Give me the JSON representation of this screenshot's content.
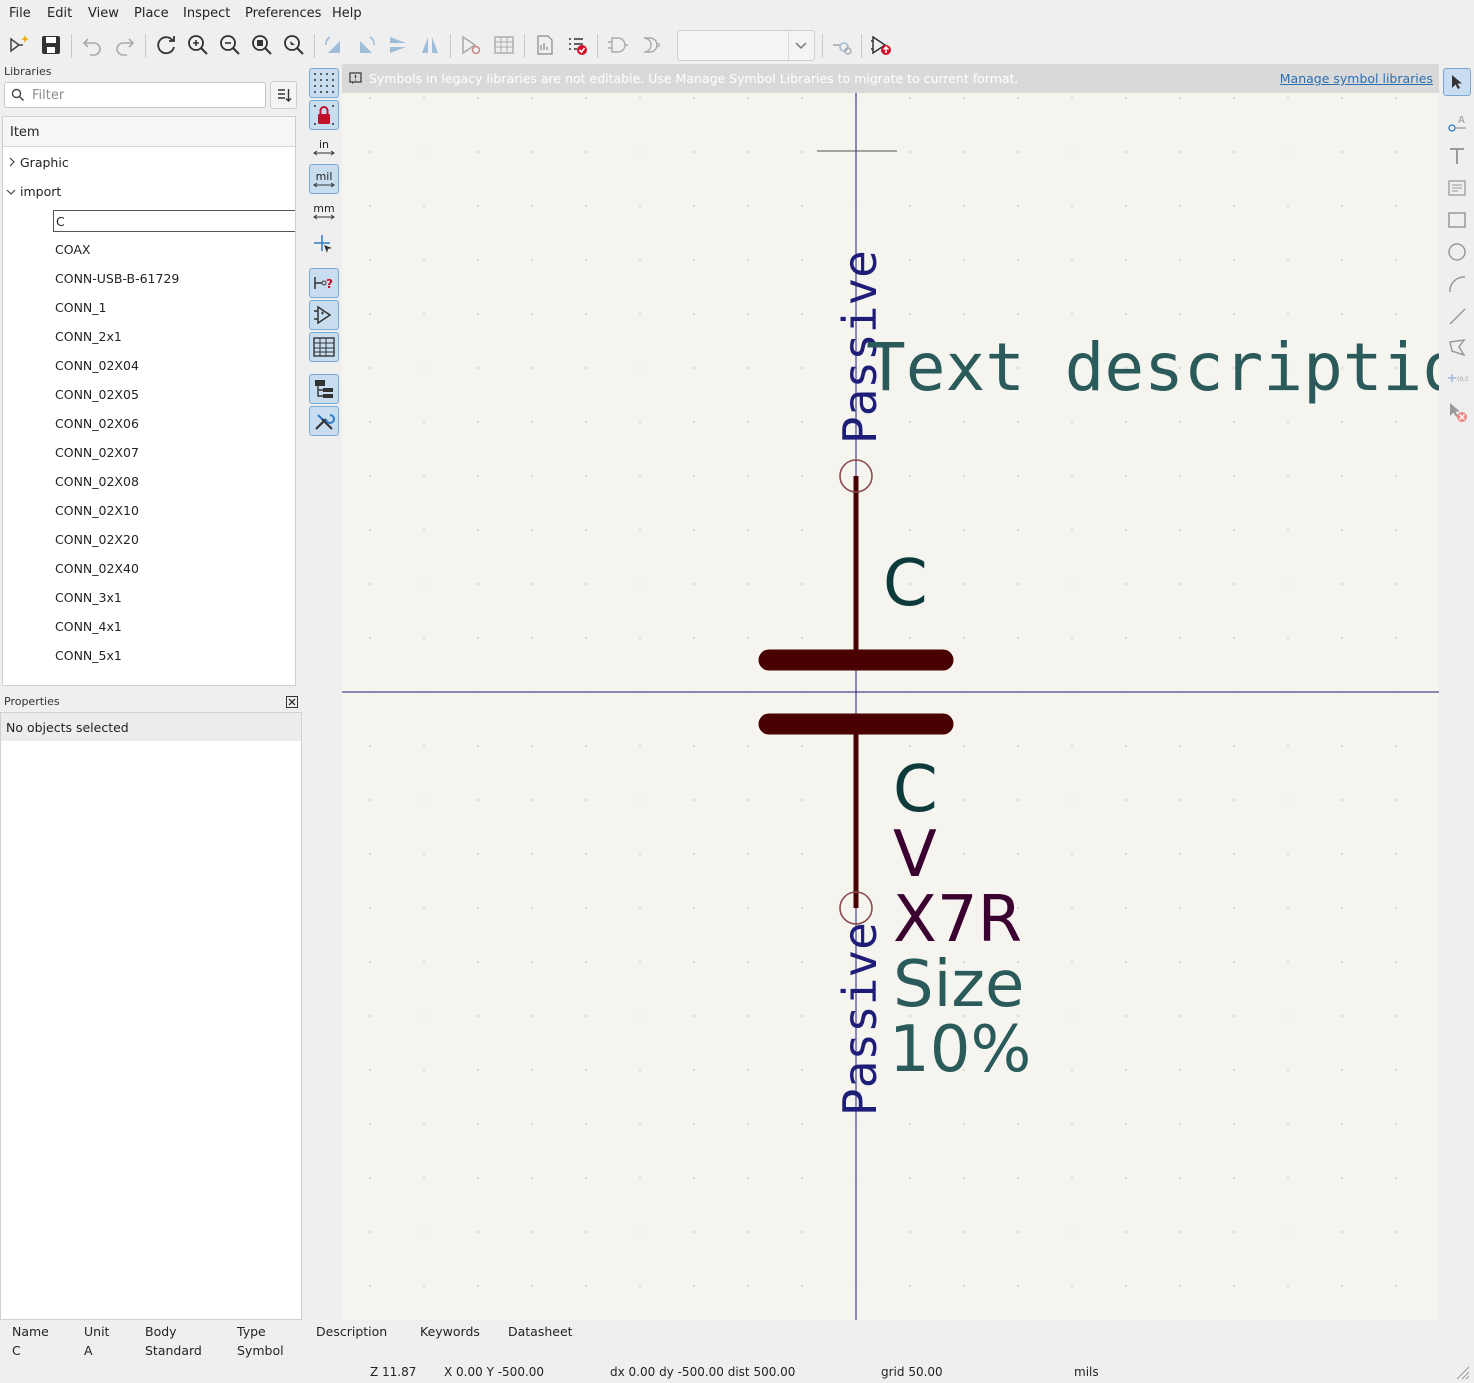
{
  "menu": [
    "File",
    "Edit",
    "View",
    "Place",
    "Inspect",
    "Preferences",
    "Help"
  ],
  "libraries": {
    "title": "Libraries",
    "filter_placeholder": "Filter",
    "column_header": "Item",
    "groups": [
      {
        "label": "Graphic",
        "expanded": false
      },
      {
        "label": "import",
        "expanded": true
      }
    ],
    "items": [
      "C",
      "COAX",
      "CONN-USB-B-61729",
      "CONN_1",
      "CONN_2x1",
      "CONN_02X04",
      "CONN_02X05",
      "CONN_02X06",
      "CONN_02X07",
      "CONN_02X08",
      "CONN_02X10",
      "CONN_02X20",
      "CONN_02X40",
      "CONN_3x1",
      "CONN_4x1",
      "CONN_5x1"
    ]
  },
  "properties": {
    "title": "Properties",
    "empty_text": "No objects selected"
  },
  "left_tools": {
    "unit_in": "in",
    "unit_mil": "mil",
    "unit_mm": "mm"
  },
  "infobar": {
    "message": "Symbols in legacy libraries are not editable.  Use Manage Symbol Libraries to migrate to current format.",
    "link": "Manage symbol libraries"
  },
  "canvas": {
    "pin_top_type": "Passive",
    "pin_bottom_type": "Passive",
    "text_description": "Text description",
    "reference": "C",
    "value": "C",
    "field_v": "V",
    "field_dielectric": "X7R",
    "field_size": "Size",
    "field_tolerance": "10%",
    "colors": {
      "background": "#f5f4ef",
      "body": "#4a0000",
      "pin_text": "#1e1e78",
      "field_teal": "#2a5a5a",
      "field_dark": "#0d3a3a",
      "field_maroon": "#3a0030",
      "axis": "#1e1e78"
    }
  },
  "status": {
    "headers": [
      "Name",
      "Unit",
      "Body",
      "Type",
      "Description",
      "Keywords",
      "Datasheet"
    ],
    "values": [
      "C",
      "A",
      "Standard",
      "Symbol",
      "",
      "",
      ""
    ],
    "zoom": "Z 11.87",
    "xy": "X 0.00  Y -500.00",
    "delta": "dx 0.00  dy -500.00  dist 500.00",
    "grid": "grid 50.00",
    "units": "mils"
  }
}
